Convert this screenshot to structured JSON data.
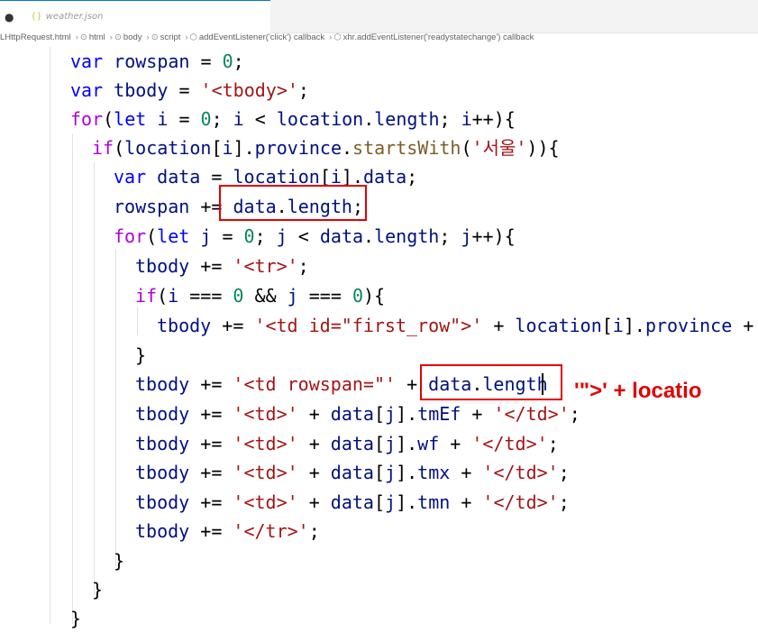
{
  "tab": {
    "dot": "●",
    "icon": "{}",
    "filename": "weather.json"
  },
  "breadcrumb": [
    "LHttpRequest.html",
    "html",
    "body",
    "script",
    "addEventListener('click') callback",
    "xhr.addEventListener('readystatechange') callback"
  ],
  "code": {
    "l1": "var rowspan = 0;",
    "l2": "var tbody = '<tbody>';",
    "l3": "for(let i = 0; i < location.length; i++){",
    "l4": "if(location[i].province.startsWith('서울')){",
    "l5": "var data = location[i].data;",
    "l6": "rowspan += data.length;",
    "l7": "for(let j = 0; j < data.length; j++){",
    "l8": "tbody += '<tr>';",
    "l9": "if(i === 0 && j === 0){",
    "l10": "tbody += '<td id=\"first_row\">' + location[i].province +",
    "l11": "}",
    "l12": "tbody += '<td rowspan=\"' + data.length",
    "l13": "tbody += '<td>' + data[j].tmEf + '</td>';",
    "l14": "tbody += '<td>' + data[j].wf + '</td>';",
    "l15": "tbody += '<td>' + data[j].tmx + '</td>';",
    "l16": "tbody += '<td>' + data[j].tmn + '</td>';",
    "l17": "tbody += '</tr>';",
    "l18": "}",
    "l19": "}",
    "l20": "}"
  },
  "annotation": "'\">' + locatio",
  "colors": {
    "highlight": "#e60000",
    "keyword": "#af00db",
    "string": "#a31515",
    "number": "#098658"
  }
}
